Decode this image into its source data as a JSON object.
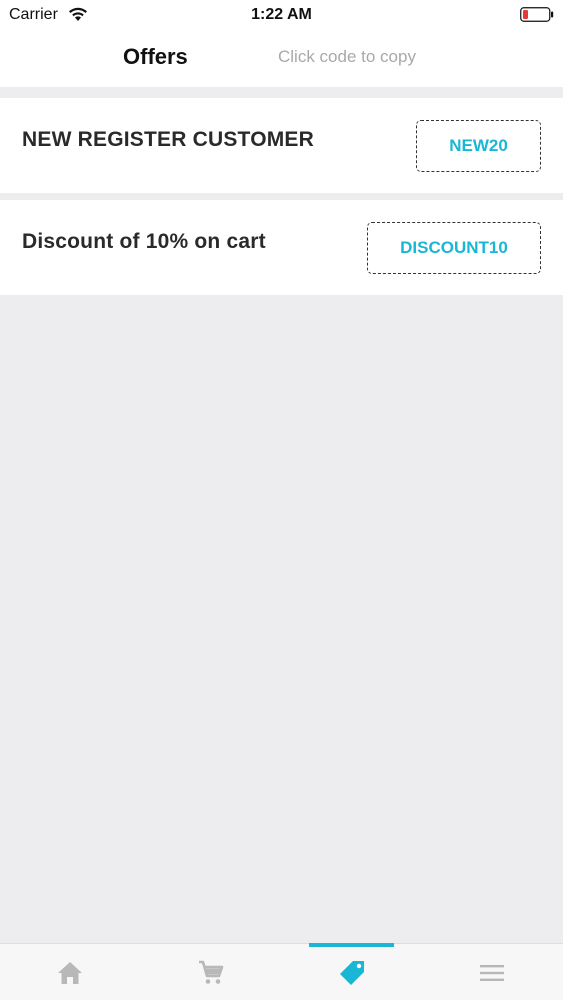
{
  "status_bar": {
    "carrier": "Carrier",
    "time": "1:22 AM",
    "icons": [
      "wifi-icon",
      "battery-icon"
    ]
  },
  "header": {
    "title": "Offers",
    "hint": "Click code to copy"
  },
  "offers": [
    {
      "title": "NEW REGISTER CUSTOMER",
      "code": "NEW20"
    },
    {
      "title": "Discount of 10% on cart",
      "code": "DISCOUNT10"
    }
  ],
  "tab_bar": {
    "tabs": [
      {
        "icon": "home-icon",
        "active": false
      },
      {
        "icon": "cart-icon",
        "active": false
      },
      {
        "icon": "tag-icon",
        "active": true
      },
      {
        "icon": "menu-icon",
        "active": false
      }
    ]
  },
  "colors": {
    "accent": "#1ab6d6",
    "background": "#edecee",
    "inactive_icon": "#b8b8b8",
    "battery_low": "#e53935"
  }
}
